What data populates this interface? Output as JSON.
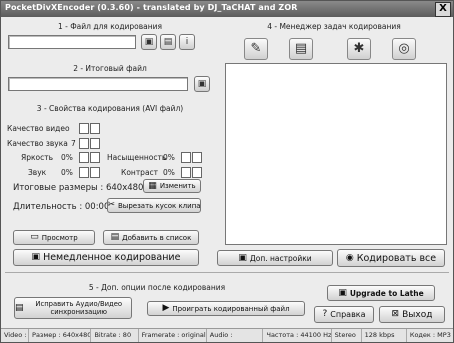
{
  "window": {
    "title": "PocketDivXEncoder (0.3.60) - translated by DJ_TaCHAT and ZOR",
    "close_glyph": "X"
  },
  "sections": {
    "source": "1 - Файл для кодирования",
    "output": "2 - Итоговый файл",
    "props": "3 - Свойства кодирования (AVI файл)",
    "manager": "4 - Менеджер задач кодирования",
    "post": "5 - Доп. опции после кодирования"
  },
  "source": {
    "value": ""
  },
  "output": {
    "value": ""
  },
  "props": {
    "video_quality_label": "Качество видео",
    "video_quality_value": "",
    "audio_quality_label": "Качество звука",
    "audio_quality_value": "7",
    "brightness_label": "Яркость",
    "brightness_value": "0%",
    "saturation_label": "Насыщенность",
    "saturation_value": "0%",
    "volume_label": "Звук",
    "volume_value": "0%",
    "contrast_label": "Контраст",
    "contrast_value": "0%",
    "final_size_label": "Итоговые размеры : 640x480",
    "change_button": "Изменить",
    "duration_label": "Длительность : 00:00",
    "cut_button": "Вырезать кусок клипа"
  },
  "buttons": {
    "preview": "Просмотр",
    "add_to_list": "Добавить в список",
    "encode_now": "Немедленное кодирование",
    "extra_settings": "Доп. настройки",
    "encode_all": "Кодировать все",
    "fix_av_sync": "Исправить Аудио/Видео синхронизацию",
    "play_encoded": "Проиграть кодированный файл",
    "upgrade": "Upgrade to Lathe",
    "help": "Справка",
    "exit": "Выход"
  },
  "icons": {
    "browse": "folder-icon",
    "save": "save-icon",
    "info": "info-icon",
    "tool1": "wizard-icon",
    "tool2": "folder-open-icon",
    "tool3": "settings-icon",
    "tool4": "disc-icon"
  },
  "status": {
    "video": "Video :",
    "size": "Размер : 640x480",
    "bitrate": "Bitrate : 80",
    "framerate": "Framerate : original",
    "audio": "Audio :",
    "frequency": "Частота : 44100 Hz",
    "stereo": "Stereo",
    "kbps": "128 kbps",
    "codec": "Кодек : MP3"
  }
}
